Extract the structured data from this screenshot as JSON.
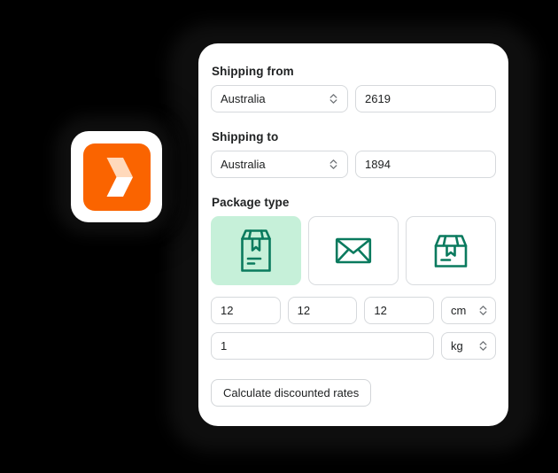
{
  "card": {
    "shipping_from": {
      "label": "Shipping from",
      "country": "Australia",
      "postcode": "2619"
    },
    "shipping_to": {
      "label": "Shipping to",
      "country": "Australia",
      "postcode": "1894"
    },
    "package_type": {
      "label": "Package type",
      "options": [
        {
          "name": "satchel-box",
          "icon": "tall-box-icon",
          "selected": true
        },
        {
          "name": "envelope",
          "icon": "envelope-icon",
          "selected": false
        },
        {
          "name": "carton-box",
          "icon": "wide-box-icon",
          "selected": false
        }
      ]
    },
    "dimensions": {
      "length": "12",
      "width": "12",
      "height": "12",
      "unit": "cm"
    },
    "weight": {
      "value": "1",
      "unit": "kg"
    },
    "calculate_button": "Calculate discounted rates"
  },
  "logo": {
    "name": "app-logo",
    "icon": "chevron-right-logo",
    "background": "#fa6400",
    "glyph_light": "#ffd9bb",
    "glyph_white": "#ffffff"
  },
  "colors": {
    "accent_green": "#0a7a5e",
    "selected_tile_bg": "#c6f0d9",
    "text": "#202223",
    "border": "#d6d9dc",
    "card_bg": "#ffffff",
    "page_bg": "#000000"
  }
}
